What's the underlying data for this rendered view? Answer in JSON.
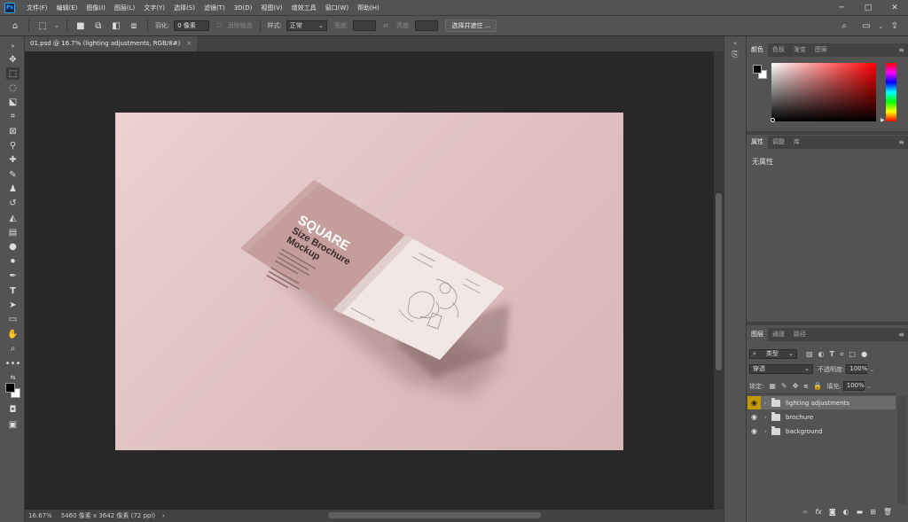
{
  "app": {
    "logo_text": "Ps",
    "window_controls": [
      "─",
      "□",
      "✕"
    ]
  },
  "menubar": {
    "items": [
      "文件(F)",
      "编辑(E)",
      "图像(I)",
      "图层(L)",
      "文字(Y)",
      "选择(S)",
      "滤镜(T)",
      "3D(D)",
      "视图(V)",
      "增效工具",
      "窗口(W)",
      "帮助(H)"
    ]
  },
  "options": {
    "feather_label": "羽化:",
    "feather_value": "0 像素",
    "antialias_label": "消除锯齿",
    "style_label": "样式:",
    "style_value": "正常",
    "width_label": "宽度:",
    "height_label": "高度:",
    "select_mask_button": "选择并遮住 ..."
  },
  "document": {
    "tab_title": "01.psd @ 16.7% (lighting adjustments, RGB/8#)",
    "tab_close": "×",
    "artboard_color": "#e4c6c6"
  },
  "mockup": {
    "title_line1": "SQUARE",
    "title_line2": "Size Brochure",
    "title_line3": "Mockup",
    "cover_color": "#c79d9b",
    "inner_color": "#f4e8e8"
  },
  "status": {
    "zoom": "16.67%",
    "dimensions": "5460 像素 x 3642 像素 (72 ppi)",
    "arrow": "›"
  },
  "color_panel": {
    "tabs": [
      "颜色",
      "色板",
      "渐变",
      "图案"
    ],
    "foreground": "#000000",
    "background": "#ffffff"
  },
  "properties_panel": {
    "tabs": [
      "属性",
      "调整",
      "库"
    ],
    "empty_text": "无属性"
  },
  "layers_panel": {
    "tabs": [
      "图层",
      "通道",
      "路径"
    ],
    "filter_label": "类型",
    "blend_mode": "穿透",
    "opacity_label": "不透明度:",
    "opacity_value": "100%",
    "lock_label": "锁定:",
    "fill_label": "填充:",
    "fill_value": "100%",
    "layers": [
      {
        "name": "lighting adjustments",
        "selected": true
      },
      {
        "name": "brochure",
        "selected": false
      },
      {
        "name": "background",
        "selected": false
      }
    ],
    "footer_icons": [
      "link-icon",
      "fx-icon",
      "mask-icon",
      "adjustment-icon",
      "group-icon",
      "new-layer-icon",
      "trash-icon"
    ],
    "footer_glyphs": [
      "∞",
      "fx",
      "◙",
      "◐",
      "▬",
      "⊞",
      "🗑"
    ]
  }
}
